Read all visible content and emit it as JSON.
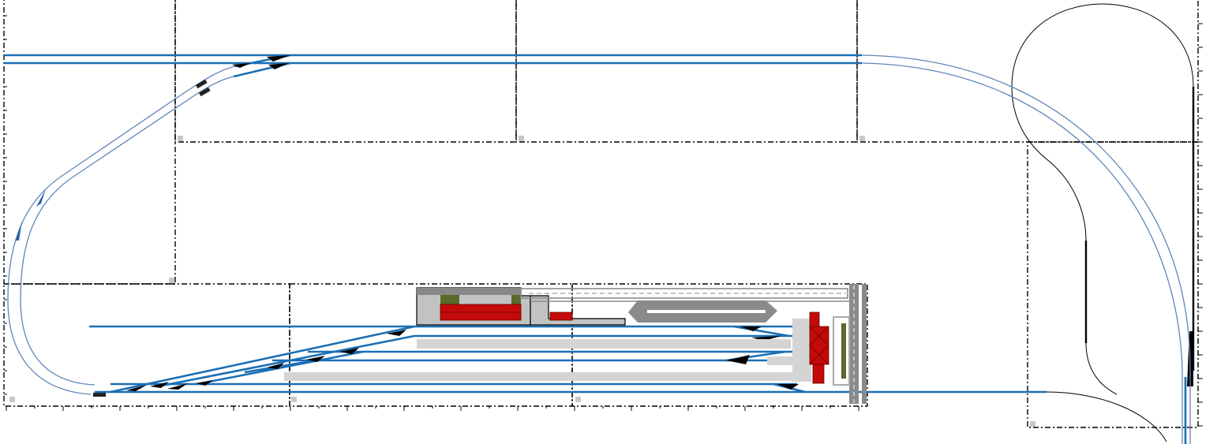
{
  "plan": {
    "title": "",
    "board_style": "dash-dot",
    "colors": {
      "main_track": "#1a6fb5",
      "curve_track": "#5f86b8",
      "board_edge": "#000000",
      "building": "#c2c2c2",
      "building_accent": "#c50a0a",
      "greenery": "#596a2a",
      "platform": "#d4d4d4"
    },
    "layers": [
      "baseboards",
      "scale-ticks",
      "tracks",
      "turnouts",
      "platforms",
      "station-buildings",
      "road-and-car-park",
      "cattle-dock",
      "helix"
    ]
  }
}
